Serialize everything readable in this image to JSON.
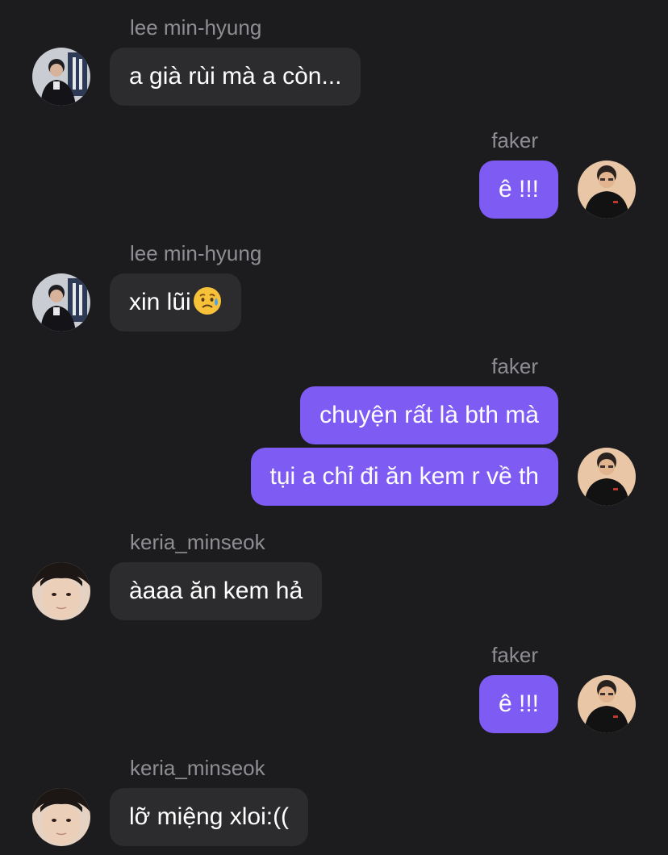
{
  "messages": [
    {
      "sender": "lee min-hyung",
      "text": "a già rùi mà a còn..."
    },
    {
      "sender": "faker",
      "text": "ê !!!"
    },
    {
      "sender": "lee min-hyung",
      "text": "xin lũi",
      "emoji": "sad-but-relieved-face-emoji"
    },
    {
      "sender": "faker",
      "text": "chuyện rất là bth mà"
    },
    {
      "text": "tụi a chỉ đi ăn kem r về th"
    },
    {
      "sender": "keria_minseok",
      "text": "àaaa ăn kem hả"
    },
    {
      "sender": "faker",
      "text": "ê !!!"
    },
    {
      "sender": "keria_minseok",
      "text": "lỡ miệng xloi:(("
    }
  ],
  "colors": {
    "background": "#1c1c1e",
    "incoming_bubble": "#2c2c2e",
    "outgoing_bubble": "#7e5bf3",
    "sender_name": "#8e8e93",
    "message_text": "#ffffff"
  }
}
